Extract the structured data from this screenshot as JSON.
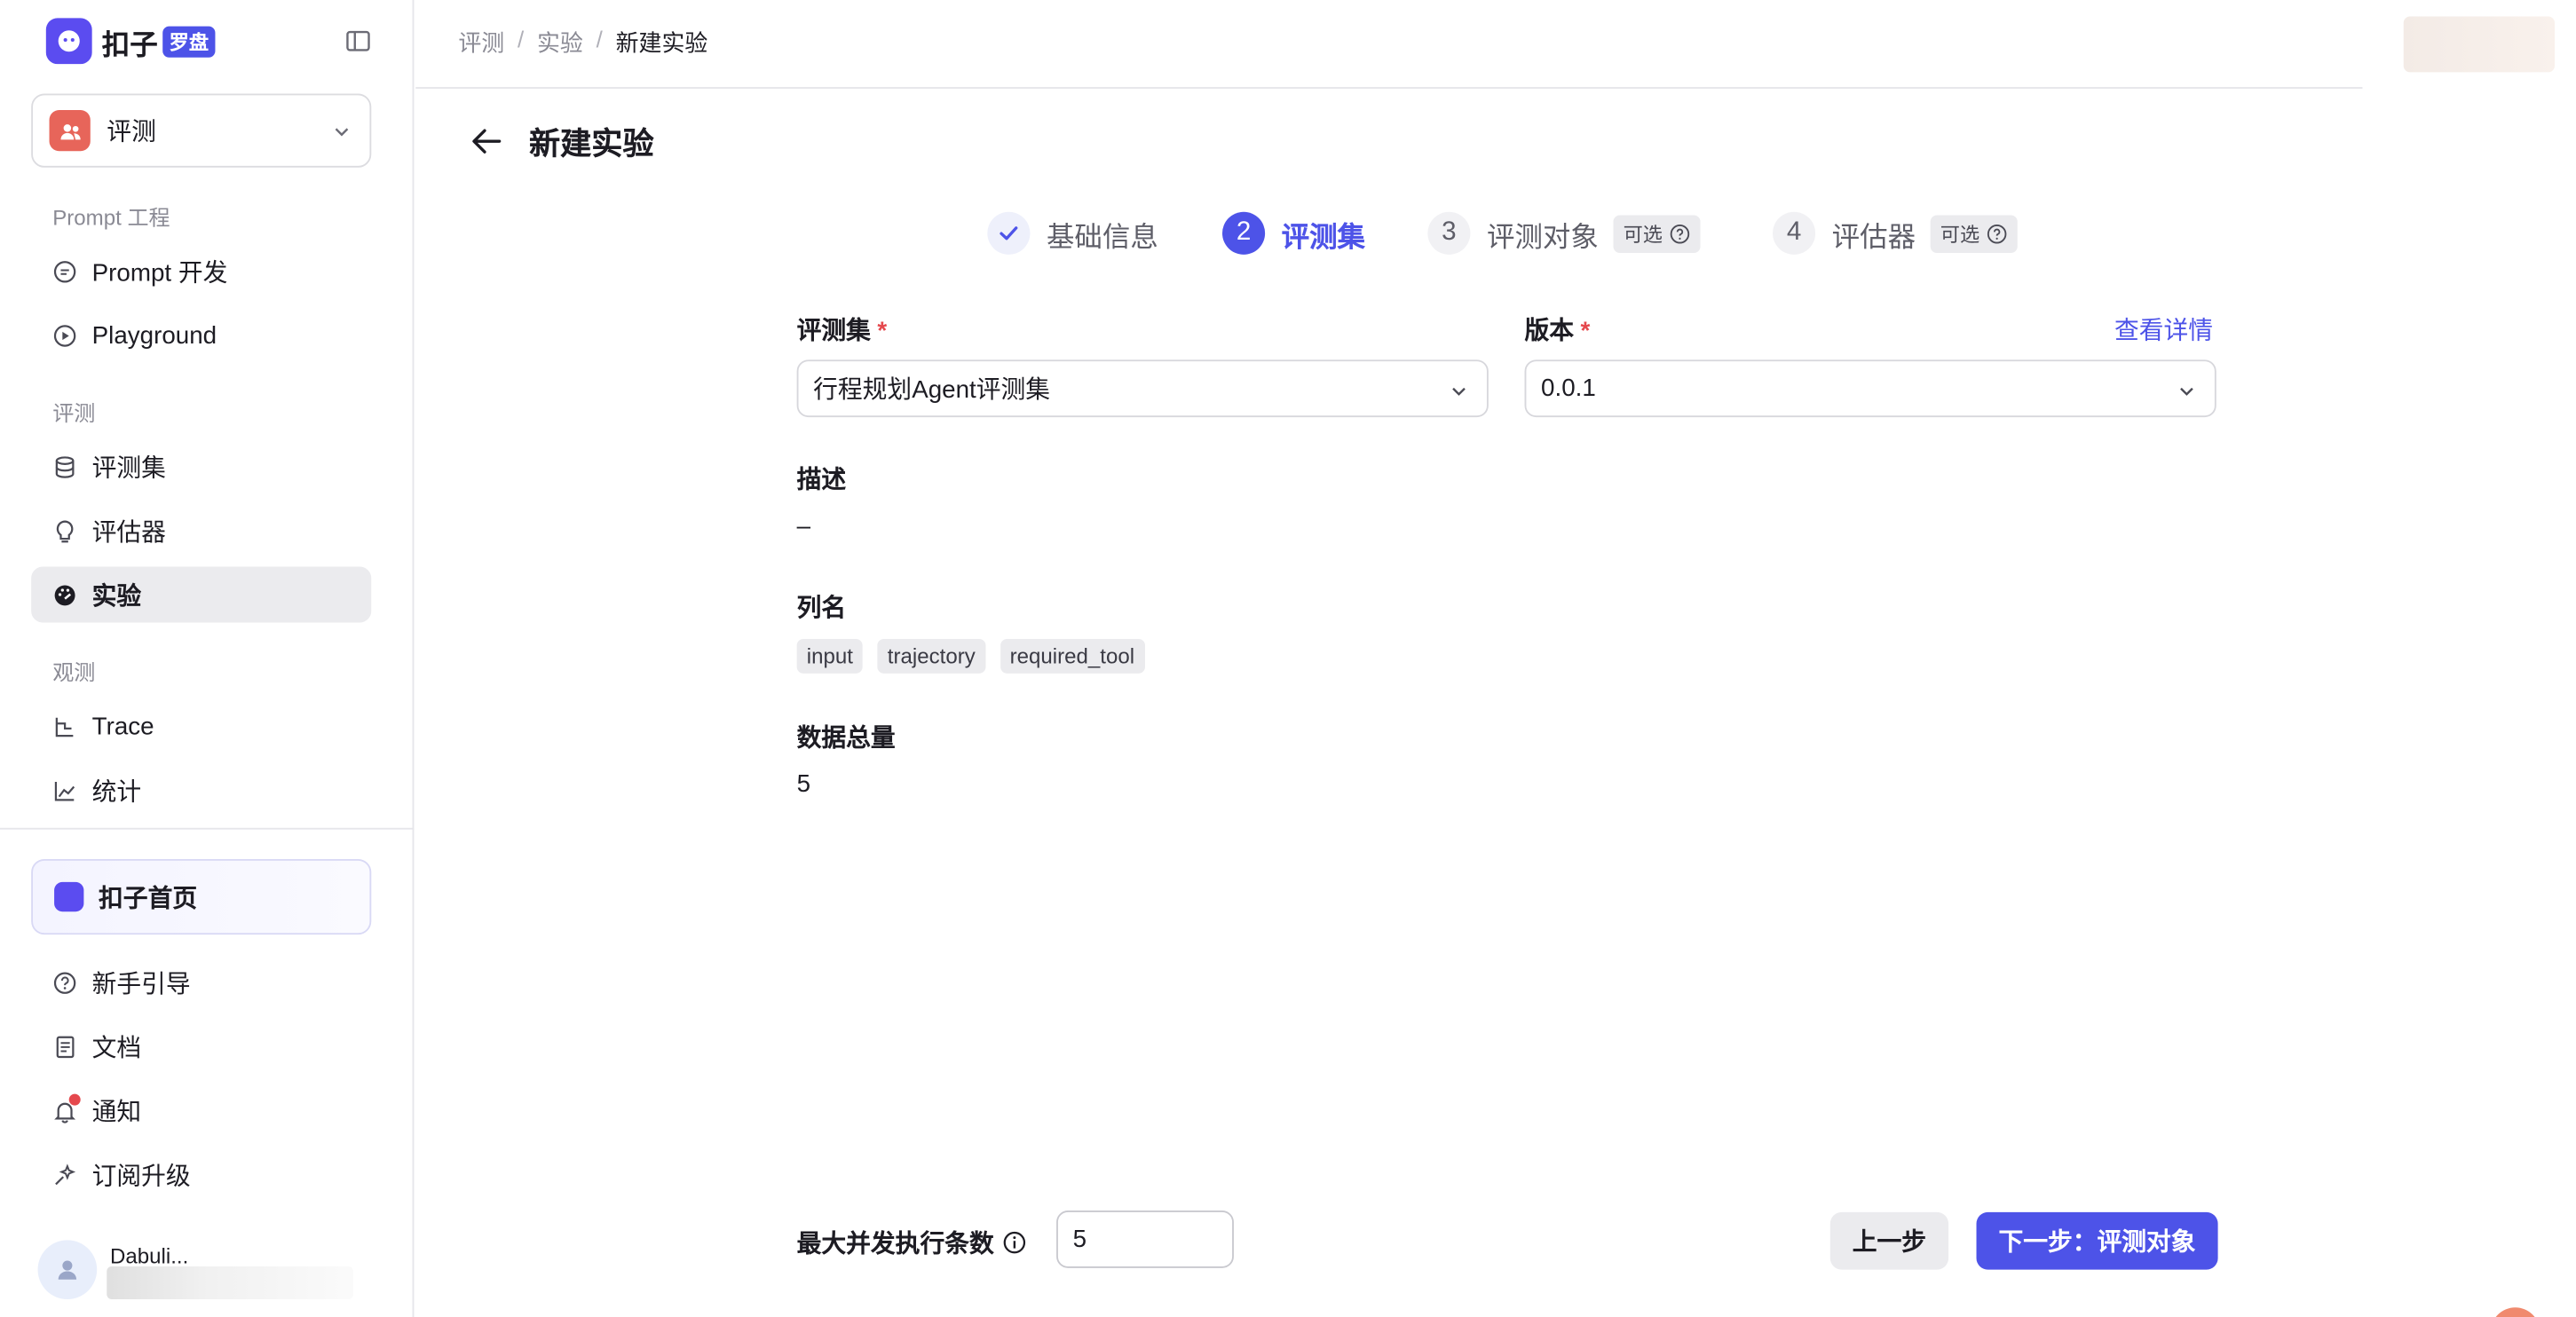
{
  "brand": {
    "name": "扣子",
    "badge": "罗盘",
    "color": "#4d53e8"
  },
  "space": {
    "name": "评测"
  },
  "sidebar": {
    "groups": [
      {
        "label": "Prompt 工程",
        "items": [
          {
            "label": "Prompt 开发",
            "icon": "chat-bubble-icon"
          },
          {
            "label": "Playground",
            "icon": "play-circle-icon"
          }
        ]
      },
      {
        "label": "评测",
        "items": [
          {
            "label": "评测集",
            "icon": "database-icon"
          },
          {
            "label": "评估器",
            "icon": "bulb-icon"
          },
          {
            "label": "实验",
            "icon": "gauge-icon",
            "active": true
          }
        ]
      },
      {
        "label": "观测",
        "items": [
          {
            "label": "Trace",
            "icon": "trace-icon"
          },
          {
            "label": "统计",
            "icon": "chart-icon"
          }
        ]
      }
    ],
    "home": "扣子首页",
    "bottom_items": [
      {
        "label": "新手引导",
        "icon": "question-circle-icon"
      },
      {
        "label": "文档",
        "icon": "document-icon"
      },
      {
        "label": "通知",
        "icon": "bell-icon"
      },
      {
        "label": "订阅升级",
        "icon": "sparkle-icon"
      }
    ],
    "user": {
      "name": "Dabuli..."
    }
  },
  "breadcrumb": [
    "评测",
    "实验",
    "新建实验"
  ],
  "page": {
    "title": "新建实验"
  },
  "steps": [
    {
      "num": "",
      "label": "基础信息",
      "state": "done",
      "optional": ""
    },
    {
      "num": "2",
      "label": "评测集",
      "state": "current",
      "optional": ""
    },
    {
      "num": "3",
      "label": "评测对象",
      "state": "todo",
      "optional": "可选"
    },
    {
      "num": "4",
      "label": "评估器",
      "state": "todo",
      "optional": "可选"
    }
  ],
  "form": {
    "dataset_label": "评测集",
    "dataset_value": "行程规划Agent评测集",
    "version_label": "版本",
    "version_value": "0.0.1",
    "details_link": "查看详情",
    "required_mark": "*",
    "desc_label": "描述",
    "desc_value": "–",
    "columns_label": "列名",
    "columns": [
      "input",
      "trajectory",
      "required_tool"
    ],
    "total_label": "数据总量",
    "total_value": "5"
  },
  "footer": {
    "concurrency_label": "最大并发执行条数",
    "concurrency_value": "5",
    "prev": "上一步",
    "next": "下一步：评测对象"
  }
}
